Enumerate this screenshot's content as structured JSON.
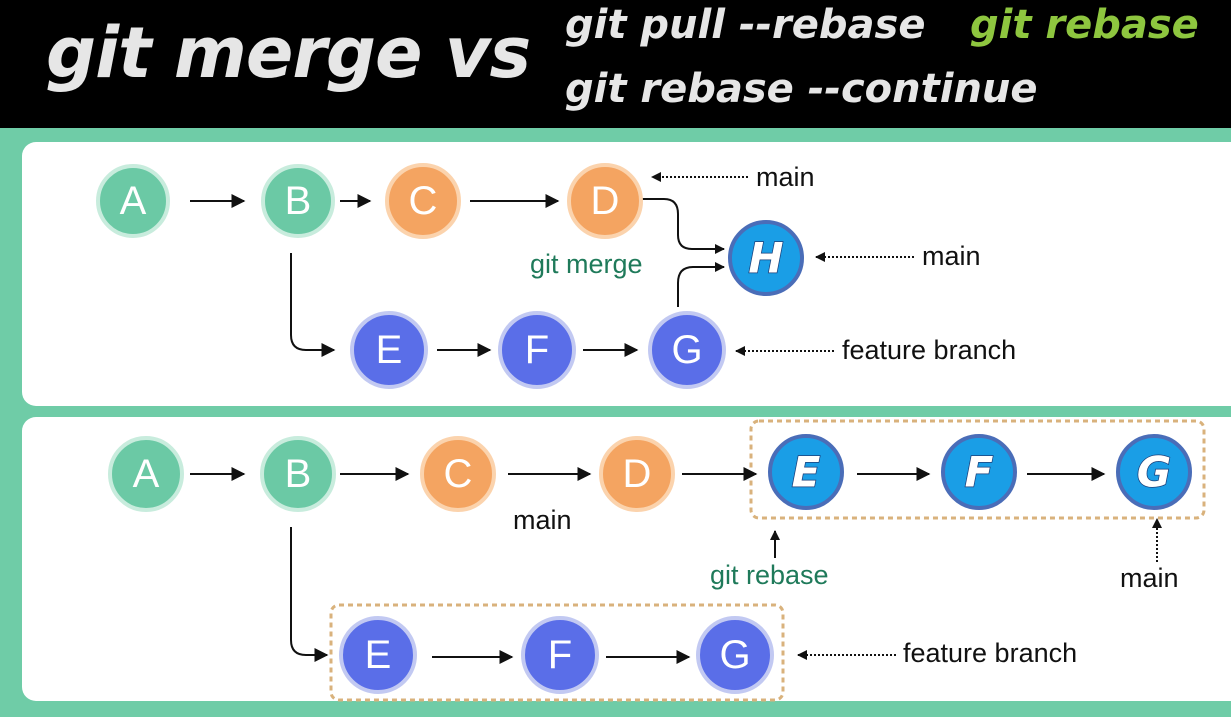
{
  "header": {
    "title": "git merge vs",
    "cmd_pull_rebase": "git pull --rebase",
    "cmd_rebase": "git rebase",
    "cmd_continue": "git rebase --continue"
  },
  "merge_diagram": {
    "nodes": {
      "a": "A",
      "b": "B",
      "c": "C",
      "d": "D",
      "e": "E",
      "f": "F",
      "g": "G",
      "h": "H"
    },
    "label_main_top": "main",
    "label_main_merge": "main",
    "label_git_merge": "git merge",
    "label_feature_branch": "feature branch"
  },
  "rebase_diagram": {
    "nodes": {
      "a": "A",
      "b": "B",
      "c": "C",
      "d": "D",
      "e_new": "E",
      "f_new": "F",
      "g_new": "G",
      "e": "E",
      "f": "F",
      "g": "G"
    },
    "label_main_d": "main",
    "label_git_rebase": "git rebase",
    "label_main_g": "main",
    "label_feature_branch": "feature branch"
  },
  "colors": {
    "green_node": "#6bc9a5",
    "orange_node": "#f4a461",
    "blue_node": "#5a6ee8",
    "bright_blue_node": "#1a9ee6",
    "background": "#6fcca7",
    "rebase_highlight": "#8ec63f",
    "dashed_box": "#d9b27c"
  }
}
